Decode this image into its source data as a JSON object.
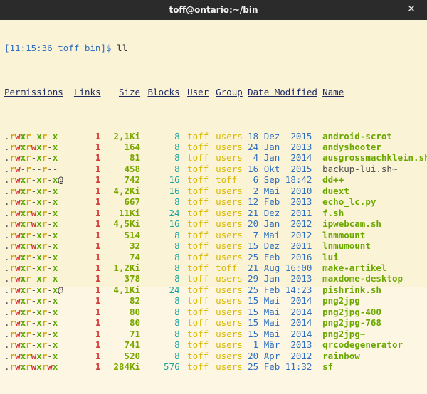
{
  "window": {
    "title": "toff@ontario:~/bin",
    "close_glyph": "✕"
  },
  "prompt": {
    "text": "[11:15:36 toff bin]$",
    "command": "ll"
  },
  "headers": [
    "Permissions",
    "Links",
    "Size",
    "Blocks",
    "User",
    "Group",
    "Date Modified",
    "Name"
  ],
  "rows": [
    {
      "perm": ".rwxr-xr-x",
      "links": "1",
      "size": "2,1Ki",
      "blocks": "8",
      "user": "toff",
      "group": "users",
      "date": "18 Dez  2015",
      "name": "android-scrot",
      "exec": true
    },
    {
      "perm": ".rwxrwxr-x",
      "links": "1",
      "size": "164",
      "blocks": "8",
      "user": "toff",
      "group": "users",
      "date": "24 Jan  2013",
      "name": "andyshooter",
      "exec": true
    },
    {
      "perm": ".rwxr-xr-x",
      "links": "1",
      "size": "81",
      "blocks": "8",
      "user": "toff",
      "group": "users",
      "date": " 4 Jan  2014",
      "name": "ausgrossmachklein.sh",
      "exec": true
    },
    {
      "perm": ".rw-r--r--",
      "links": "1",
      "size": "458",
      "blocks": "8",
      "user": "toff",
      "group": "users",
      "date": "16 Okt  2015",
      "name": "backup-lui.sh~",
      "exec": false
    },
    {
      "perm": ".rwxr-xr-x@",
      "links": "1",
      "size": "742",
      "blocks": "16",
      "user": "toff",
      "group": "toff",
      "date": " 6 Sep 18:42",
      "name": "dd++",
      "exec": true
    },
    {
      "perm": ".rwxr-xr-x",
      "links": "1",
      "size": "4,2Ki",
      "blocks": "16",
      "user": "toff",
      "group": "users",
      "date": " 2 Mai  2010",
      "name": "duext",
      "exec": true
    },
    {
      "perm": ".rwxr-xr-x",
      "links": "1",
      "size": "667",
      "blocks": "8",
      "user": "toff",
      "group": "users",
      "date": "12 Feb  2013",
      "name": "echo_lc.py",
      "exec": true
    },
    {
      "perm": ".rwxrwxr-x",
      "links": "1",
      "size": "11Ki",
      "blocks": "24",
      "user": "toff",
      "group": "users",
      "date": "21 Dez  2011",
      "name": "f.sh",
      "exec": true
    },
    {
      "perm": ".rwxrwxr-x",
      "links": "1",
      "size": "4,5Ki",
      "blocks": "16",
      "user": "toff",
      "group": "users",
      "date": "20 Jan  2012",
      "name": "ipwebcam.sh",
      "exec": true
    },
    {
      "perm": ".rwxr-xr-x",
      "links": "1",
      "size": "514",
      "blocks": "8",
      "user": "toff",
      "group": "users",
      "date": " 7 Mai  2012",
      "name": "lnmmount",
      "exec": true
    },
    {
      "perm": ".rwxrwxr-x",
      "links": "1",
      "size": "32",
      "blocks": "8",
      "user": "toff",
      "group": "users",
      "date": "15 Dez  2011",
      "name": "lnmumount",
      "exec": true
    },
    {
      "perm": ".rwxr-xr-x",
      "links": "1",
      "size": "74",
      "blocks": "8",
      "user": "toff",
      "group": "users",
      "date": "25 Feb  2016",
      "name": "lui",
      "exec": true
    },
    {
      "perm": ".rwxr-xr-x",
      "links": "1",
      "size": "1,2Ki",
      "blocks": "8",
      "user": "toff",
      "group": "toff",
      "date": "21 Aug 16:00",
      "name": "make-artikel",
      "exec": true
    },
    {
      "perm": ".rwxr-xr-x",
      "links": "1",
      "size": "378",
      "blocks": "8",
      "user": "toff",
      "group": "users",
      "date": "29 Jan  2013",
      "name": "maxdome-desktop",
      "exec": true
    },
    {
      "perm": ".rwxr-xr-x@",
      "links": "1",
      "size": "4,1Ki",
      "blocks": "24",
      "user": "toff",
      "group": "users",
      "date": "25 Feb 14:23",
      "name": "pishrink.sh",
      "exec": true
    },
    {
      "perm": ".rwxr-xr-x",
      "links": "1",
      "size": "82",
      "blocks": "8",
      "user": "toff",
      "group": "users",
      "date": "15 Mai  2014",
      "name": "png2jpg",
      "exec": true
    },
    {
      "perm": ".rwxr-xr-x",
      "links": "1",
      "size": "80",
      "blocks": "8",
      "user": "toff",
      "group": "users",
      "date": "15 Mai  2014",
      "name": "png2jpg-400",
      "exec": true
    },
    {
      "perm": ".rwxr-xr-x",
      "links": "1",
      "size": "80",
      "blocks": "8",
      "user": "toff",
      "group": "users",
      "date": "15 Mai  2014",
      "name": "png2jpg-768",
      "exec": true
    },
    {
      "perm": ".rwxr-xr-x",
      "links": "1",
      "size": "71",
      "blocks": "8",
      "user": "toff",
      "group": "users",
      "date": "15 Mai  2014",
      "name": "png2jpg~",
      "exec": true
    },
    {
      "perm": ".rwxr-xr-x",
      "links": "1",
      "size": "741",
      "blocks": "8",
      "user": "toff",
      "group": "users",
      "date": " 1 Mär  2013",
      "name": "qrcodegenerator",
      "exec": true
    },
    {
      "perm": ".rwxrwxr-x",
      "links": "1",
      "size": "520",
      "blocks": "8",
      "user": "toff",
      "group": "users",
      "date": "20 Apr  2012",
      "name": "rainbow",
      "exec": true
    },
    {
      "perm": ".rwxrwxrwx",
      "links": "1",
      "size": "284Ki",
      "blocks": "576",
      "user": "toff",
      "group": "users",
      "date": "25 Feb 11:32",
      "name": "sf",
      "exec": true
    }
  ],
  "colors": {
    "background": "#fbf3d5",
    "titlebar": "#2b2b2b",
    "prompt": "#2f6fbf",
    "links": "#d43a3a",
    "size": "#78a800",
    "blocks": "#1aa6a0",
    "owner": "#d7b800",
    "date": "#2f6fbf",
    "exec_name": "#6aa800"
  }
}
